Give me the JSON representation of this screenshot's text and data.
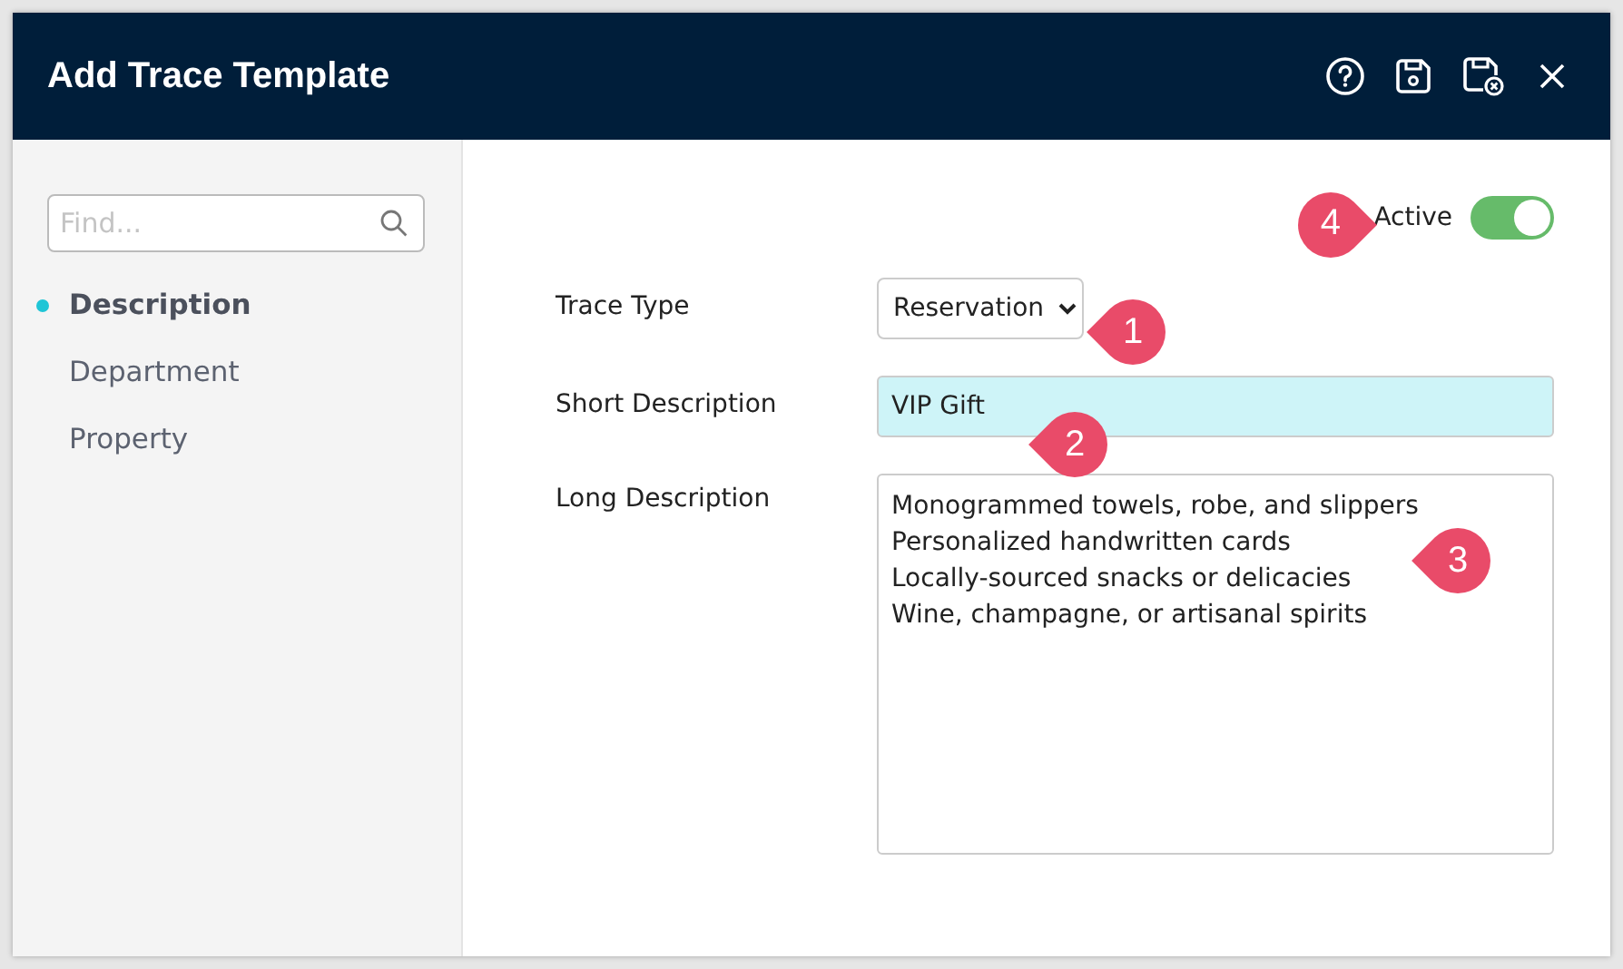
{
  "window": {
    "title": "Add Trace Template"
  },
  "toolbar": [
    {
      "kind": "help"
    },
    {
      "kind": "save"
    },
    {
      "kind": "save-close"
    },
    {
      "kind": "close"
    }
  ],
  "sidebar": {
    "search": {
      "placeholder": "Find..."
    },
    "items": [
      {
        "label": "Description",
        "selected": true
      },
      {
        "label": "Department",
        "selected": false
      },
      {
        "label": "Property",
        "selected": false
      }
    ]
  },
  "active": {
    "label": "Active",
    "on": true,
    "marker": "4"
  },
  "fields": [
    {
      "kind": "select",
      "label": "Trace Type",
      "value": "Reservation",
      "marker": "1"
    },
    {
      "kind": "text",
      "label": "Short Description",
      "value": "VIP Gift",
      "marker": "2"
    },
    {
      "kind": "textarea",
      "label": "Long Description",
      "value": [
        "Monogrammed towels, robe, and slippers",
        "Personalized handwritten cards",
        "Locally-sourced snacks or delicacies",
        "Wine, champagne, or artisanal spirits"
      ],
      "marker": "3"
    }
  ]
}
